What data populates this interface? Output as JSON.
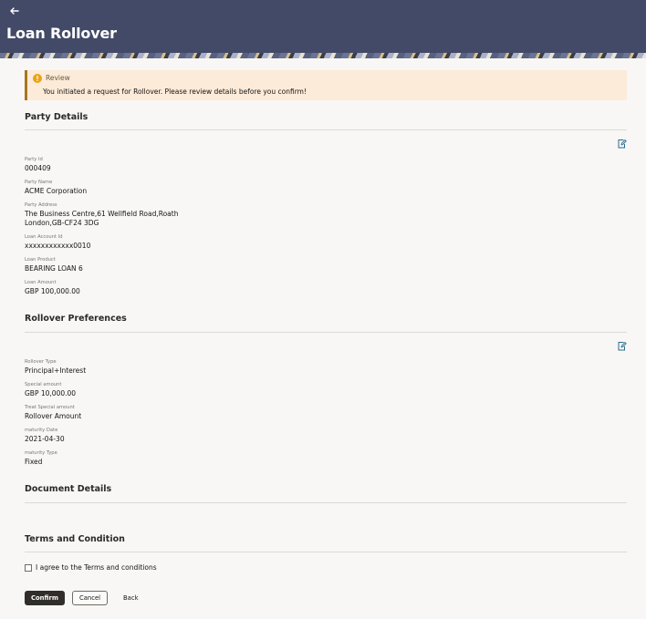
{
  "header": {
    "title": "Loan Rollover"
  },
  "review": {
    "title": "Review",
    "message": "You initiated a request for Rollover. Please review details before you confirm!"
  },
  "party_details": {
    "title": "Party Details",
    "fields": [
      {
        "label": "Party Id",
        "value": "000409"
      },
      {
        "label": "Party Name",
        "value": "ACME Corporation"
      },
      {
        "label": "Party Address",
        "value_line1": "The Business Centre,61 Wellfield Road,Roath",
        "value_line2": "London,GB-CF24 3DG"
      },
      {
        "label": "Loan Account Id",
        "value": "xxxxxxxxxxxx0010"
      },
      {
        "label": "Loan Product",
        "value": "BEARING LOAN 6"
      },
      {
        "label": "Loan Amount",
        "value": "GBP 100,000.00"
      }
    ]
  },
  "rollover_preferences": {
    "title": "Rollover Preferences",
    "fields": [
      {
        "label": "Rollover Type",
        "value": "Principal+Interest"
      },
      {
        "label": "Special amount",
        "value": "GBP 10,000.00"
      },
      {
        "label": "Treat Special amount",
        "value": "Rollover Amount"
      },
      {
        "label": "maturity Date",
        "value": "2021-04-30"
      },
      {
        "label": "maturity Type",
        "value": "Fixed"
      }
    ]
  },
  "document_details": {
    "title": "Document Details"
  },
  "terms": {
    "title": "Terms and Condition",
    "checkbox_label": "I agree to the Terms and conditions"
  },
  "actions": {
    "confirm": "Confirm",
    "cancel": "Cancel",
    "back": "Back"
  },
  "colors": {
    "header_bg": "#434a67",
    "review_bg": "#fcebd9",
    "warning": "#e8a317",
    "edit_icon": "#2a6b8a",
    "primary_button": "#312d2a"
  }
}
